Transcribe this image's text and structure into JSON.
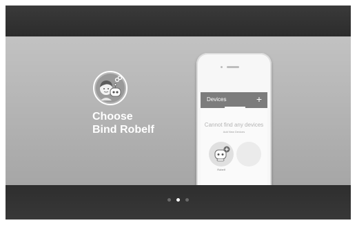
{
  "onboarding": {
    "title_line1": "Choose",
    "title_line2": "Bind Robelf"
  },
  "phone_app": {
    "header_title": "Devices",
    "add_icon": "plus-icon",
    "add_glyph": "+",
    "empty_title": "Cannot find any devices",
    "empty_subtitle": "Add New Devices",
    "devices": [
      {
        "label": "Robelf",
        "icon": "robot-add-icon"
      }
    ]
  },
  "pagination": {
    "count": 3,
    "active_index": 1
  },
  "colors": {
    "panel": "#b4b4b4",
    "band": "#2f2f2f",
    "app_header": "#7c7c7c",
    "text_light": "#ffffff"
  }
}
